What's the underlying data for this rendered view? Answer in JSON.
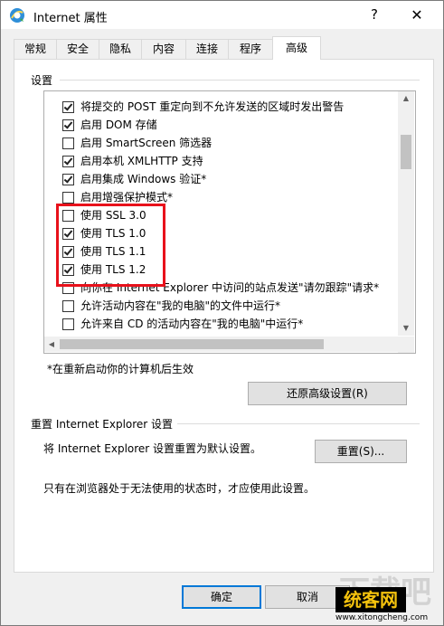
{
  "window": {
    "title": "Internet 属性",
    "help_label": "?",
    "close_label": "✕"
  },
  "tabs": [
    {
      "label": "常规"
    },
    {
      "label": "安全"
    },
    {
      "label": "隐私"
    },
    {
      "label": "内容"
    },
    {
      "label": "连接"
    },
    {
      "label": "程序"
    },
    {
      "label": "高级",
      "active": true
    }
  ],
  "settings": {
    "group_label": "设置",
    "items": [
      {
        "label": "将提交的 POST 重定向到不允许发送的区域时发出警告",
        "checked": true
      },
      {
        "label": "启用 DOM 存储",
        "checked": true
      },
      {
        "label": "启用 SmartScreen 筛选器",
        "checked": false
      },
      {
        "label": "启用本机 XMLHTTP 支持",
        "checked": true
      },
      {
        "label": "启用集成 Windows 验证*",
        "checked": true
      },
      {
        "label": "启用增强保护模式*",
        "checked": false
      },
      {
        "label": "使用 SSL 3.0",
        "checked": false
      },
      {
        "label": "使用 TLS 1.0",
        "checked": true
      },
      {
        "label": "使用 TLS 1.1",
        "checked": true
      },
      {
        "label": "使用 TLS 1.2",
        "checked": true
      },
      {
        "label": "向你在 Internet Explorer 中访问的站点发送\"请勿跟踪\"请求*",
        "checked": false
      },
      {
        "label": "允许活动内容在\"我的电脑\"的文件中运行*",
        "checked": false
      },
      {
        "label": "允许来自 CD 的活动内容在\"我的电脑\"中运行*",
        "checked": false
      }
    ],
    "restart_note": "*在重新启动你的计算机后生效",
    "restore_button": "还原高级设置(R)"
  },
  "reset": {
    "group_label": "重置 Internet Explorer 设置",
    "description": "将 Internet Explorer 设置重置为默认设置。",
    "reset_button": "重置(S)...",
    "note": "只有在浏览器处于无法使用的状态时，才应使用此设置。"
  },
  "footer": {
    "ok_button": "确定",
    "cancel_button": "取消"
  },
  "watermark": {
    "big_text": "下载吧",
    "badge_text": "统客网",
    "url_text": "www.xitongcheng.com"
  },
  "colors": {
    "highlight": "#e8111b",
    "focus_border": "#0078d7"
  }
}
